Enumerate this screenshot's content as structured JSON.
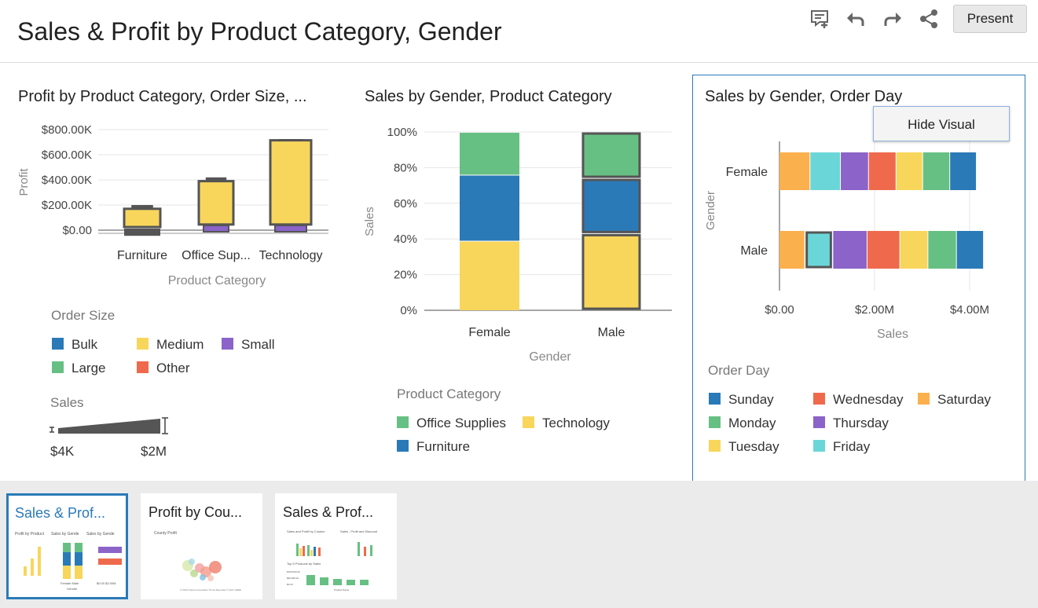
{
  "page": {
    "title": "Sales & Profit by Product Category, Gender",
    "present_label": "Present",
    "toolbar_icons": [
      "add-note-icon",
      "undo-icon",
      "redo-icon",
      "share-icon"
    ]
  },
  "viz1": {
    "title": "Profit by Product Category, Order Size, ...",
    "legend_title": "Order Size",
    "legend": [
      {
        "label": "Bulk",
        "color": "#2a7ab8"
      },
      {
        "label": "Medium",
        "color": "#f8d65c"
      },
      {
        "label": "Small",
        "color": "#8b63c9"
      },
      {
        "label": "Large",
        "color": "#67c083"
      },
      {
        "label": "Other",
        "color": "#ef6a4c"
      }
    ],
    "size_legend_title": "Sales",
    "size_min": "$4K",
    "size_max": "$2M"
  },
  "viz2": {
    "title": "Sales by Gender, Product Category",
    "legend_title": "Product Category",
    "legend": [
      {
        "label": "Office Supplies",
        "color": "#67c083"
      },
      {
        "label": "Technology",
        "color": "#f8d65c"
      },
      {
        "label": "Furniture",
        "color": "#2a7ab8"
      }
    ]
  },
  "viz3": {
    "title": "Sales by Gender, Order Day",
    "menu_label": "Hide Visual",
    "legend_title": "Order Day",
    "legend": [
      {
        "label": "Sunday",
        "color": "#2a7ab8"
      },
      {
        "label": "Wednesday",
        "color": "#ef6a4c"
      },
      {
        "label": "Saturday",
        "color": "#fbb04e"
      },
      {
        "label": "Monday",
        "color": "#67c083"
      },
      {
        "label": "Thursday",
        "color": "#8b63c9"
      },
      {
        "label": "Tuesday",
        "color": "#f8d65c"
      },
      {
        "label": "Friday",
        "color": "#6bd6d8"
      }
    ]
  },
  "chart_data": [
    {
      "type": "bar",
      "title": "Profit by Product Category, Order Size, ...",
      "xlabel": "Product Category",
      "ylabel": "Profit",
      "categories": [
        "Furniture",
        "Office Sup...",
        "Technology"
      ],
      "yticks": [
        "$0.00",
        "$200.00K",
        "$400.00K",
        "$600.00K",
        "$800.00K"
      ],
      "ylim": [
        -20000,
        860000
      ],
      "series": [
        {
          "name": "Small",
          "values": [
            -20000,
            25000,
            25000
          ]
        },
        {
          "name": "Medium",
          "values": [
            170000,
            390000,
            715000
          ]
        },
        {
          "name": "Bulk",
          "values": [
            200000,
            420000,
            725000
          ]
        }
      ]
    },
    {
      "type": "bar",
      "title": "Sales by Gender, Product Category",
      "xlabel": "Gender",
      "ylabel": "Sales",
      "categories": [
        "Female",
        "Male"
      ],
      "yticks": [
        "0%",
        "20%",
        "40%",
        "60%",
        "80%",
        "100%"
      ],
      "ylim": [
        0,
        100
      ],
      "series": [
        {
          "name": "Technology",
          "values": [
            39,
            43
          ]
        },
        {
          "name": "Furniture",
          "values": [
            37,
            31
          ]
        },
        {
          "name": "Office Supplies",
          "values": [
            24,
            26
          ]
        }
      ]
    },
    {
      "type": "bar",
      "title": "Sales by Gender, Order Day",
      "xlabel": "Sales",
      "ylabel": "Gender",
      "categories": [
        "Female",
        "Male"
      ],
      "xticks": [
        "$0.00",
        "$2.00M",
        "$4.00M"
      ],
      "xlim": [
        0,
        4500000
      ],
      "series": [
        {
          "name": "Saturday",
          "values": [
            650000,
            540000
          ]
        },
        {
          "name": "Friday",
          "values": [
            640000,
            590000
          ]
        },
        {
          "name": "Thursday",
          "values": [
            590000,
            720000
          ]
        },
        {
          "name": "Wednesday",
          "values": [
            580000,
            690000
          ]
        },
        {
          "name": "Tuesday",
          "values": [
            560000,
            590000
          ]
        },
        {
          "name": "Monday",
          "values": [
            570000,
            600000
          ]
        },
        {
          "name": "Sunday",
          "values": [
            560000,
            570000
          ]
        }
      ]
    }
  ],
  "filmstrip": {
    "thumbs": [
      {
        "title": "Sales & Prof...",
        "sub": [
          "Profit by Product",
          "Sales by Gende",
          "Sales by Gende"
        ],
        "labels": [
          "Female  Male",
          "Gender",
          "$0.00  $2.00M"
        ]
      },
      {
        "title": "Profit by Cou...",
        "sub": [
          "County Profit"
        ],
        "labels": [
          "© 2016 Oracle Corporation  Terms  Map data © 2017 HERE"
        ]
      },
      {
        "title": "Sales & Prof...",
        "sub": [
          "Sales and Profit by Custom",
          "Sales , Profit and Discount",
          "Top 5 Products by Sales"
        ],
        "labels": [
          "$150,000.00",
          "$60,000.00",
          "$0.00",
          "Product Name"
        ]
      }
    ]
  }
}
